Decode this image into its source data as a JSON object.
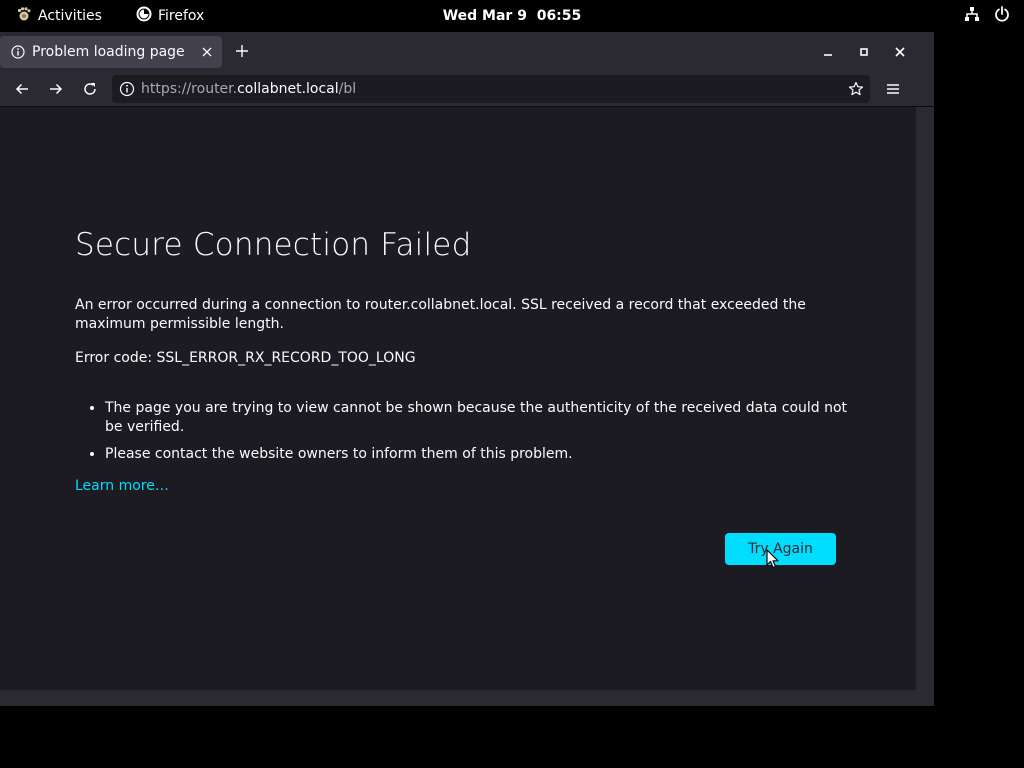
{
  "topbar": {
    "activities": "Activities",
    "app_name": "Firefox",
    "clock": "Wed Mar 9  06:55",
    "icons": [
      "network-icon",
      "power-icon"
    ]
  },
  "browser": {
    "tab_title": "Problem loading page",
    "url_prefix": "https://router.",
    "url_host": "collabnet.local",
    "url_suffix": "/bl",
    "icons": [
      "info-icon",
      "close-icon",
      "plus-icon",
      "minimize-icon",
      "maximize-icon",
      "back-icon",
      "forward-icon",
      "reload-icon",
      "star-icon",
      "menu-icon"
    ]
  },
  "error_page": {
    "title": "Secure Connection Failed",
    "description": "An error occurred during a connection to router.collabnet.local. SSL received a record that exceeded the maximum permissible length.",
    "error_code": "Error code: SSL_ERROR_RX_RECORD_TOO_LONG",
    "bullets": [
      "The page you are trying to view cannot be shown because the authenticity of the received data could not be verified.",
      "Please contact the website owners to inform them of this problem."
    ],
    "learn_more": "Learn more…",
    "try_again": "Try Again"
  },
  "colors": {
    "accent": "#00ddff",
    "page_background": "#1c1b22",
    "chrome_background": "#2b2a33",
    "text": "#fbfbfe"
  }
}
